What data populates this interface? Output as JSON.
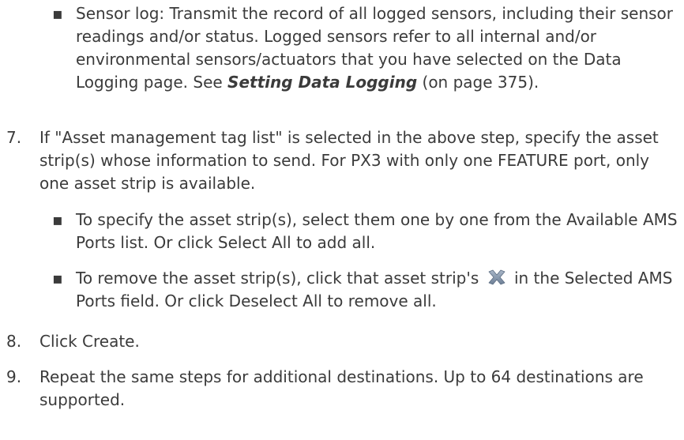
{
  "sensor_log_bullet": {
    "marker": "▪",
    "label": "Sensor log: Transmit the record of all logged sensors, including their sensor readings and/or status. Logged sensors refer to all internal and/or environmental sensors/actuators that you have selected on the Data Logging page. See",
    "link": "Setting Data Logging",
    "suffix": "(on page 375)."
  },
  "step7": {
    "number": "7.",
    "text": "If \"Asset management tag list\" is selected in the above step, specify the asset strip(s) whose information to send. For PX3 with only one FEATURE port, only one asset strip is available.",
    "bullet1": {
      "marker": "▪",
      "text": "To specify the asset strip(s), select them one by one from the Available AMS Ports list. Or click Select All to add all."
    },
    "bullet2": {
      "marker": "▪",
      "before_icon": "To remove the asset strip(s), click that asset strip's",
      "icon": "delete-x-icon",
      "after_icon": "in the Selected AMS Ports field. Or click Deselect All to remove all."
    }
  },
  "step8": {
    "number": "8.",
    "text": "Click Create."
  },
  "step9": {
    "number": "9.",
    "text": "Repeat the same steps for additional destinations. Up to 64 destinations are supported."
  },
  "colors": {
    "text": "#3b3b3b",
    "icon": "#8a9bb0"
  }
}
